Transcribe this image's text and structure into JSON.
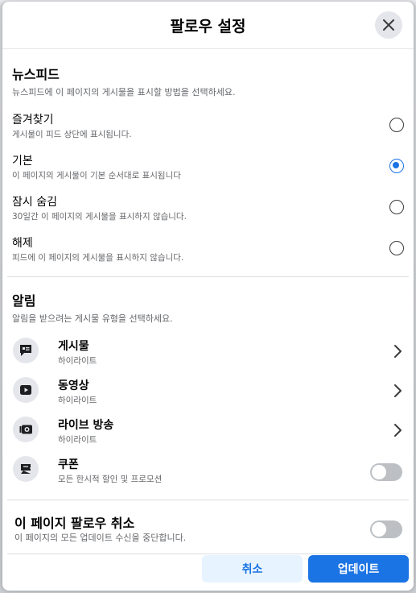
{
  "dialog": {
    "title": "팔로우 설정"
  },
  "newsfeed": {
    "title": "뉴스피드",
    "description": "뉴스피드에 이 페이지의 게시물을 표시할 방법을 선택하세요.",
    "options": [
      {
        "label": "즐겨찾기",
        "desc": "게시물이 피드 상단에 표시됩니다.",
        "selected": false
      },
      {
        "label": "기본",
        "desc": "이 페이지의 게시물이 기본 순서대로 표시됩니다",
        "selected": true
      },
      {
        "label": "잠시 숨김",
        "desc": "30일간 이 페이지의 게시물을 표시하지 않습니다.",
        "selected": false
      },
      {
        "label": "해제",
        "desc": "피드에 이 페이지의 게시물을 표시하지 않습니다.",
        "selected": false
      }
    ]
  },
  "notifications": {
    "title": "알림",
    "description": "알림을 받으려는 게시물 유형을 선택하세요.",
    "items": [
      {
        "label": "게시물",
        "desc": "하이라이트",
        "icon": "post-icon"
      },
      {
        "label": "동영상",
        "desc": "하이라이트",
        "icon": "video-icon"
      },
      {
        "label": "라이브 방송",
        "desc": "하이라이트",
        "icon": "live-icon"
      },
      {
        "label": "쿠폰",
        "desc": "모든 한시적 할인 및 프로모션",
        "icon": "coupon-icon",
        "toggle": false
      }
    ]
  },
  "unfollow": {
    "title": "이 페이지 팔로우 취소",
    "description": "이 페이지의 모든 업데이트 수신을 중단합니다.",
    "toggle": false
  },
  "footer": {
    "cancel_label": "취소",
    "update_label": "업데이트"
  },
  "colors": {
    "accent": "#1b74e4",
    "secondary_text": "#65676b"
  }
}
